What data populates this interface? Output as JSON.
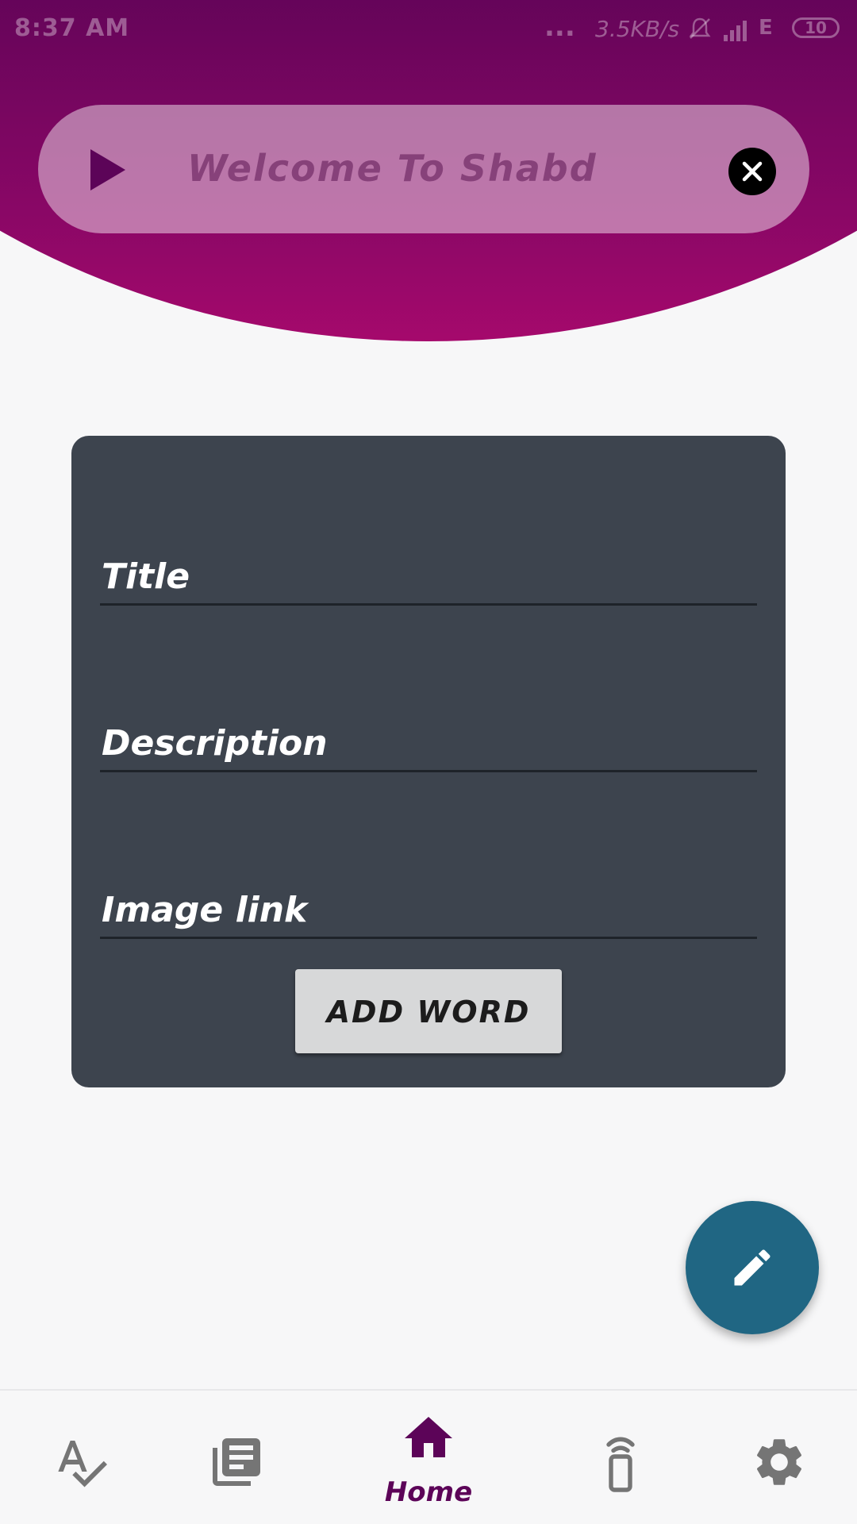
{
  "status_bar": {
    "time": "8:37 AM",
    "dots": "...",
    "speed": "3.5KB/s",
    "network": "E",
    "battery": "10"
  },
  "banner": {
    "text": "Welcome To Shabd"
  },
  "form": {
    "title_label": "Title",
    "description_label": "Description",
    "image_link_label": "Image link",
    "add_button_label": "ADD WORD"
  },
  "bottom_nav": {
    "items": [
      {
        "icon": "spellcheck-icon",
        "label": ""
      },
      {
        "icon": "library-books-icon",
        "label": ""
      },
      {
        "icon": "home-icon",
        "label": "Home"
      },
      {
        "icon": "remote-icon",
        "label": ""
      },
      {
        "icon": "settings-icon",
        "label": ""
      }
    ],
    "active_index": 2
  },
  "colors": {
    "header_top": "#5c0458",
    "header_bottom": "#a5096c",
    "card": "#3d444e",
    "fab": "#206683",
    "accent": "#5c0458",
    "nav_icon": "#757575"
  }
}
